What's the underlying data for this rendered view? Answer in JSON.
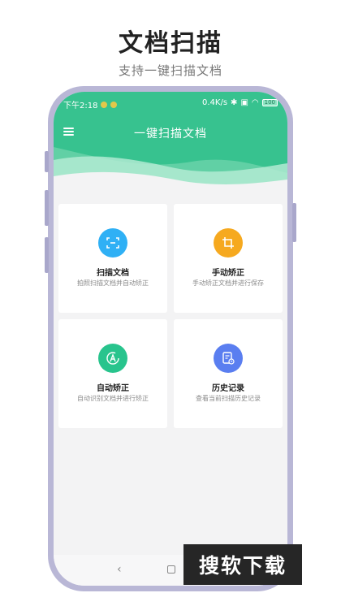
{
  "promo": {
    "headline": "文档扫描",
    "subline": "支持一键扫描文档"
  },
  "status_bar": {
    "time": "下午2:18",
    "speed": "0.4K/s",
    "battery": "100"
  },
  "app": {
    "title": "一键扫描文档"
  },
  "cards": [
    {
      "title": "扫描文档",
      "subtitle": "拍照扫描文档并自动矫正",
      "icon": "scan-icon",
      "color": "#2fb0f5"
    },
    {
      "title": "手动矫正",
      "subtitle": "手动矫正文档并进行保存",
      "icon": "crop-icon",
      "color": "#f6a91f"
    },
    {
      "title": "自动矫正",
      "subtitle": "自动识别文档并进行矫正",
      "icon": "auto-correct-icon",
      "color": "#28c48d"
    },
    {
      "title": "历史记录",
      "subtitle": "查看当前扫描历史记录",
      "icon": "history-icon",
      "color": "#5a7ef0"
    }
  ],
  "nav": {
    "back": "‹"
  },
  "watermark": {
    "text": "搜软下载"
  },
  "colors": {
    "header": "#37c28f",
    "phone_frame": "#b9b7d6"
  }
}
